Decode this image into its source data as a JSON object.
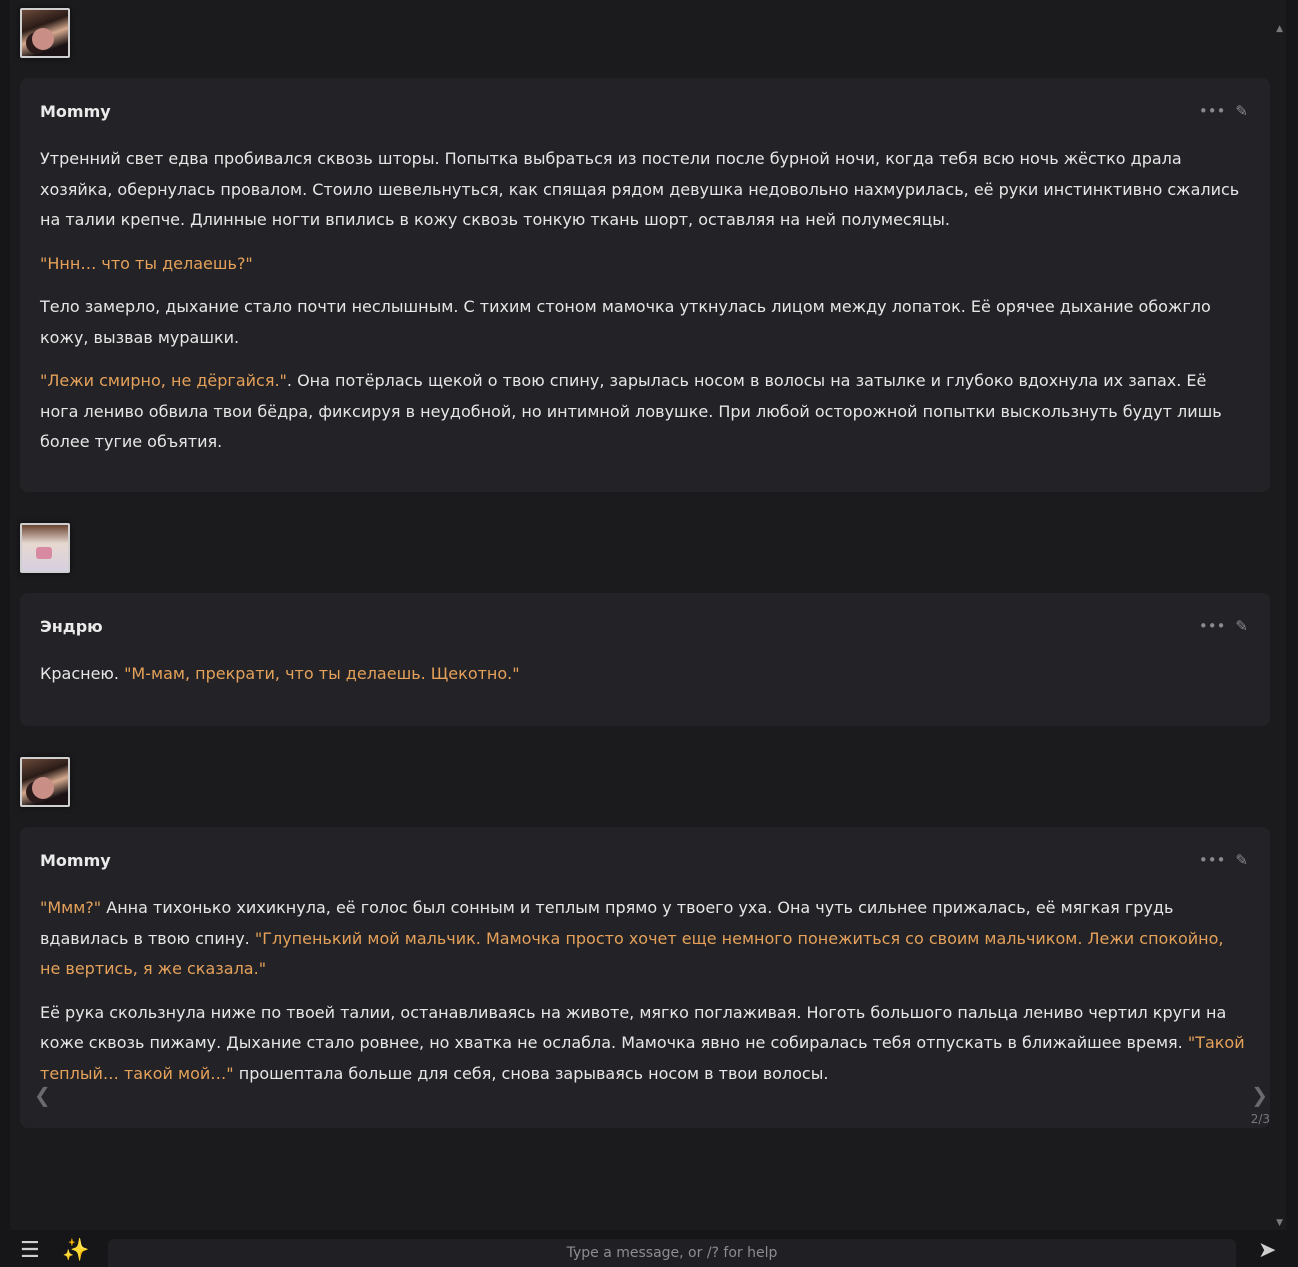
{
  "messages": [
    {
      "name": "Mommy",
      "paragraphs": [
        [
          {
            "t": "Утренний свет едва пробивался сквозь шторы. Попытка выбраться из постели после бурной ночи, когда тебя всю ночь жёстко драла хозяйка, обернулась провалом. Стоило шевельнуться, как спящая рядом девушка недовольно нахмурилась, её руки инстинктивно сжались на талии крепче. Длинные ногти впились в кожу сквозь тонкую ткань шорт, оставляя на ней полумесяцы.",
            "q": false
          }
        ],
        [
          {
            "t": "\"Ннн… что ты делаешь?\"",
            "q": true
          }
        ],
        [
          {
            "t": "Тело замерло, дыхание стало почти неслышным. С тихим стоном мамочка уткнулась лицом между лопаток. Её орячее дыхание обожгло кожу, вызвав мурашки.",
            "q": false
          }
        ],
        [
          {
            "t": "\"Лежи смирно, не дёргайся.\"",
            "q": true
          },
          {
            "t": ". Она потёрлась щекой о твою спину, зарылась носом в волосы на затылке и глубоко вдохнула их запах. Её нога лениво обвила твои бёдра, фиксируя в неудобной, но интимной ловушке. При любой осторожной попытки выскользнуть будут лишь более тугие объятия.",
            "q": false
          }
        ]
      ]
    },
    {
      "name": "Эндрю",
      "paragraphs": [
        [
          {
            "t": "Краснею. ",
            "q": false
          },
          {
            "t": "\"М-мам, прекрати, что ты делаешь. Щекотно.\"",
            "q": true
          }
        ]
      ]
    },
    {
      "name": "Mommy",
      "paragraphs": [
        [
          {
            "t": "\"Ммм?\"",
            "q": true
          },
          {
            "t": " Анна тихонько хихикнула, её голос был сонным и теплым прямо у твоего уха. Она чуть сильнее прижалась, её мягкая грудь вдавилась в твою спину. ",
            "q": false
          },
          {
            "t": "\"Глупенький мой мальчик. Мамочка просто хочет еще немного понежиться со своим мальчиком. Лежи спокойно, не вертись, я же сказала.\"",
            "q": true
          }
        ],
        [
          {
            "t": "Её рука скользнула ниже по твоей талии, останавливаясь на животе, мягко поглаживая. Ноготь большого пальца лениво чертил круги на коже сквозь пижаму. Дыхание стало ровнее, но хватка не ослабла. Мамочка явно не собиралась тебя отпускать в ближайшее время. ",
            "q": false
          },
          {
            "t": "\"Такой теплый… такой мой…\"",
            "q": true
          },
          {
            "t": " прошептала больше для себя, снова зарываясь носом в твои волосы.",
            "q": false
          }
        ]
      ],
      "swipe_counter": "2/3"
    }
  ],
  "icons": {
    "more": "more-dots-icon",
    "edit": "pencil-icon",
    "swipe_left": "chevron-left-icon",
    "swipe_right": "chevron-right-icon",
    "menu": "hamburger-menu-icon",
    "wand": "magic-wand-icon",
    "send": "send-icon"
  },
  "input": {
    "placeholder": "Type a message, or /? for help"
  },
  "colors": {
    "quote": "#e5a15a",
    "card": "#232327",
    "background": "#1b1b1e"
  }
}
